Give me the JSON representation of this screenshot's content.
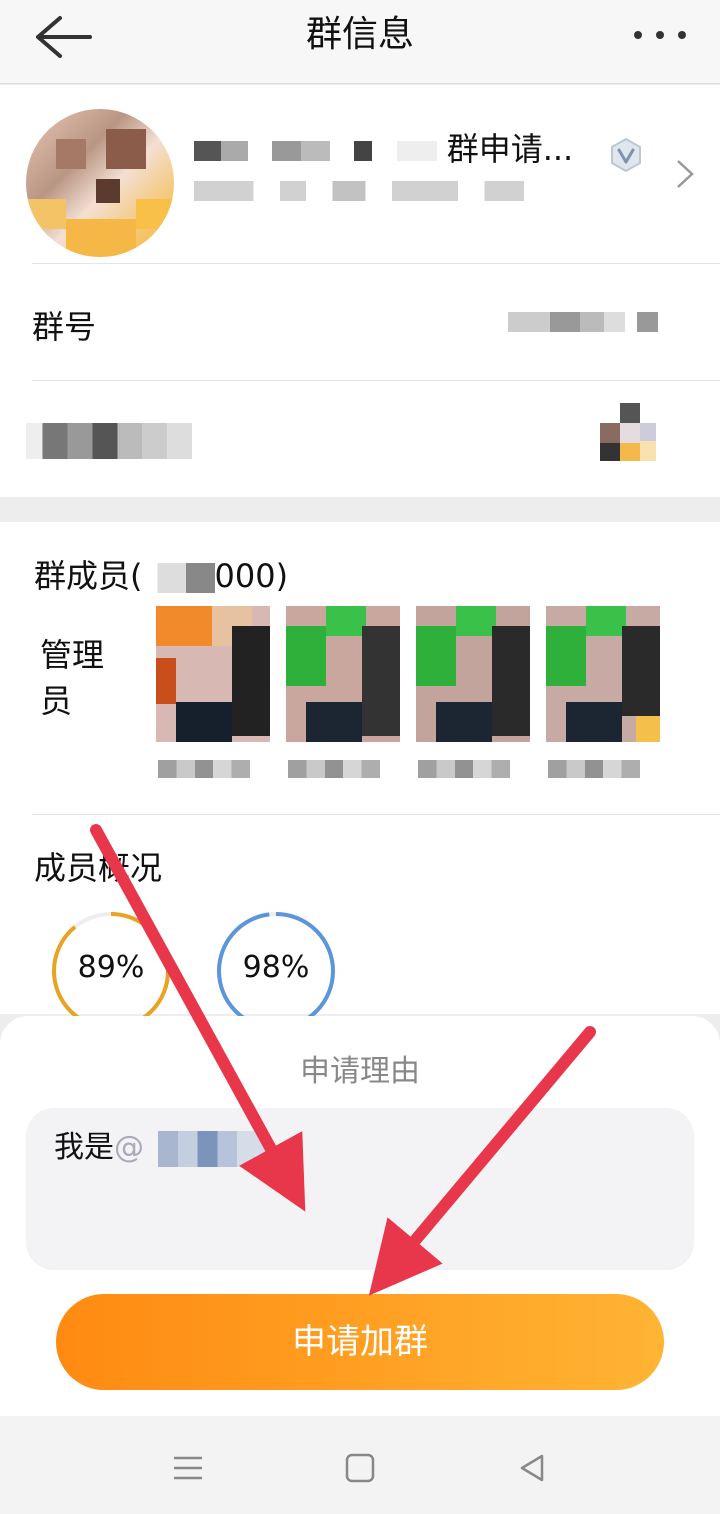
{
  "header": {
    "title": "群信息"
  },
  "group": {
    "name_suffix": "群申请..."
  },
  "rows": {
    "group_number_label": "群号"
  },
  "members": {
    "title_prefix": "群成员(",
    "title_suffix": "000)",
    "admin_label": "管理员"
  },
  "overview": {
    "title": "成员概况",
    "stats": [
      {
        "label": "89%",
        "value": 89,
        "color": "#e8a322"
      },
      {
        "label": "98%",
        "value": 98,
        "color": "#5b95dc"
      }
    ]
  },
  "sheet": {
    "title": "申请理由",
    "reason_prefix": "我是",
    "reason_at": "@",
    "apply_label": "申请加群"
  },
  "colors": {
    "accent_start": "#ff8a12",
    "accent_end": "#ffb433",
    "annotation_arrow": "#e8364a"
  }
}
